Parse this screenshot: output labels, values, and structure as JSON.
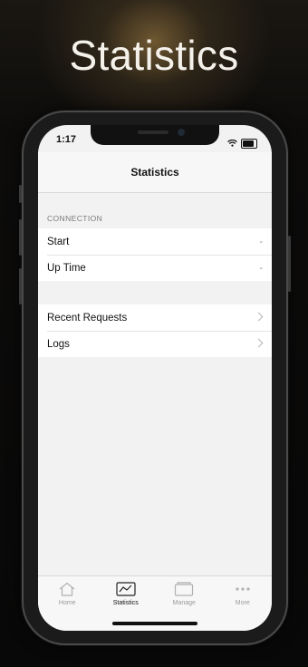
{
  "headline": "Statistics",
  "status_bar": {
    "time": "1:17"
  },
  "nav": {
    "title": "Statistics"
  },
  "connection_section": {
    "header": "CONNECTION",
    "rows": [
      {
        "label": "Start",
        "value": "-"
      },
      {
        "label": "Up Time",
        "value": "-"
      }
    ]
  },
  "links_section": {
    "rows": [
      {
        "label": "Recent Requests"
      },
      {
        "label": "Logs"
      }
    ]
  },
  "tab_bar": {
    "active_index": 1,
    "tabs": [
      {
        "label": "Home",
        "icon": "home-icon"
      },
      {
        "label": "Statistics",
        "icon": "chart-icon"
      },
      {
        "label": "Manage",
        "icon": "folder-icon"
      },
      {
        "label": "More",
        "icon": "more-icon"
      }
    ]
  }
}
